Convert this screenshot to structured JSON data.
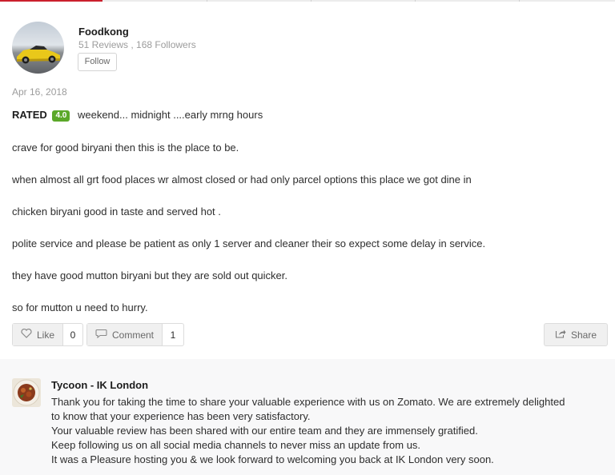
{
  "reviewer": {
    "name": "Foodkong",
    "stats": "51 Reviews , 168 Followers",
    "follow_label": "Follow"
  },
  "review": {
    "date": "Apr 16, 2018",
    "rated_label": "RATED",
    "rating": "4.0",
    "first_line": "weekend... midnight ....early mrng hours",
    "paragraphs": [
      "crave for good biryani then this is the place to be.",
      "when almost all grt food places wr almost closed or had only parcel options this place we got dine in",
      "chicken biryani good in taste and served hot .",
      "polite service and please be patient as only 1 server and cleaner their so expect some delay in service.",
      "they have good mutton biryani but they are sold out quicker.",
      "so for mutton u need to hurry."
    ]
  },
  "actions": {
    "like_label": "Like",
    "like_count": "0",
    "comment_label": "Comment",
    "comment_count": "1",
    "share_label": "Share"
  },
  "reply": {
    "name": "Tycoon - IK London",
    "lines": [
      "Thank you for taking the time to share your valuable experience with us on Zomato. We are extremely delighted",
      "to know that your experience has been very satisfactory.",
      "Your valuable review has been shared with our entire team and they are immensely gratified.",
      "Keep following us on all social media channels to never miss an update from us.",
      "It was a Pleasure hosting you & we look forward to welcoming you back at IK London very soon."
    ]
  },
  "colors": {
    "rating_badge": "#5ba829",
    "accent_red": "#cb202d"
  }
}
